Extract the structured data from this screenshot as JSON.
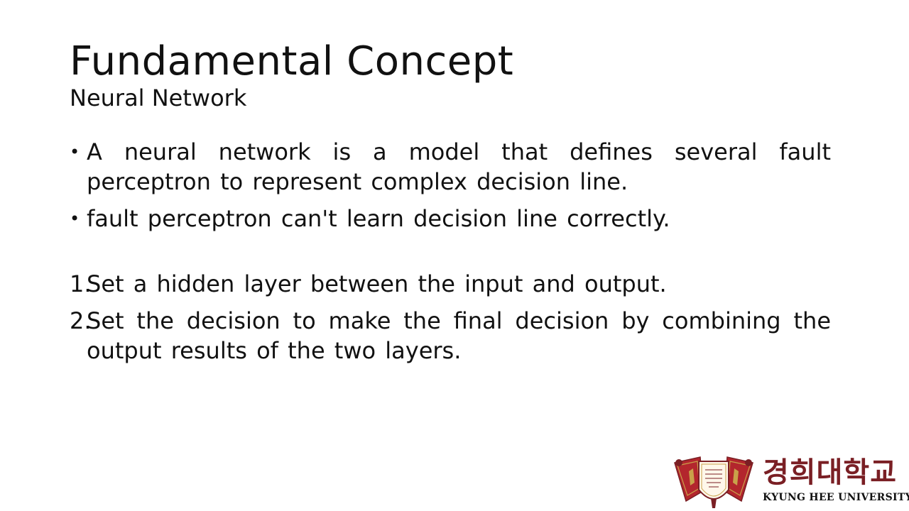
{
  "slide": {
    "title": "Fundamental Concept",
    "subtitle": "Neural Network",
    "bullets": [
      "A neural network is a model that defines several fault perceptron to represent complex decision line.",
      "fault perceptron can't learn decision line correctly."
    ],
    "numbered": [
      {
        "marker": "1.",
        "text": "Set a hidden layer between the input and output."
      },
      {
        "marker": "2.",
        "text": "Set the decision to make the final decision by combining the output results of the two layers."
      }
    ]
  },
  "logo": {
    "korean_name": "경희대학교",
    "english_name": "KYUNG HEE UNIVERSITY",
    "emblem_icon": "university-emblem-icon",
    "colors": {
      "crimson": "#7a1f24",
      "red": "#b3262d",
      "gold": "#c9a24a"
    }
  }
}
